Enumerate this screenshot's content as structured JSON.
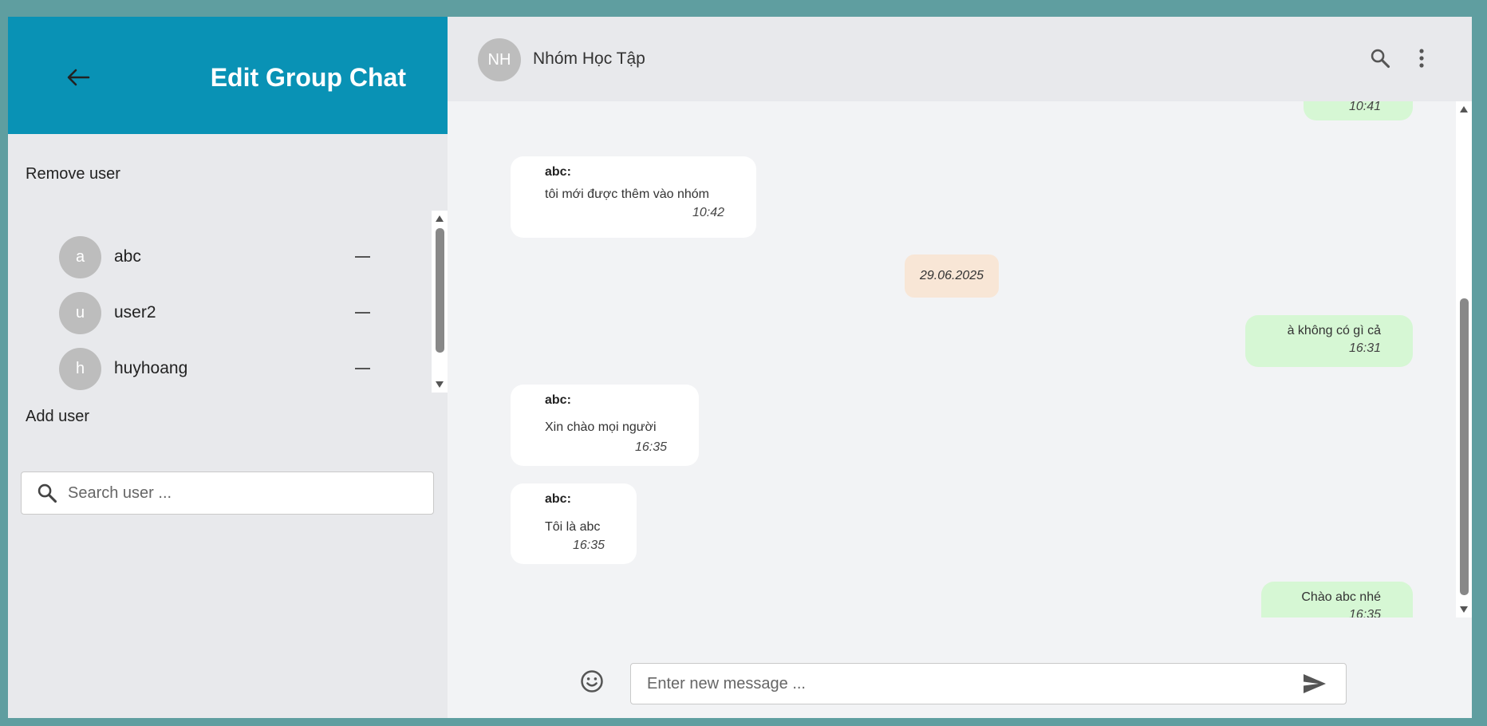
{
  "edit_panel": {
    "title": "Edit Group Chat",
    "remove_label": "Remove user",
    "add_label": "Add user",
    "search_placeholder": "Search user ...",
    "members": [
      {
        "initial": "a",
        "name": "abc"
      },
      {
        "initial": "u",
        "name": "user2"
      },
      {
        "initial": "h",
        "name": "huyhoang"
      }
    ]
  },
  "chat": {
    "avatar_initials": "NH",
    "name": "Nhóm Học Tập",
    "messages": [
      {
        "type": "out",
        "time": "10:41"
      },
      {
        "type": "in",
        "sender": "abc:",
        "text": "tôi mới được thêm vào nhóm",
        "time": "10:42"
      },
      {
        "type": "date",
        "text": "29.06.2025"
      },
      {
        "type": "out",
        "text": "à không có gì cả",
        "time": "16:31"
      },
      {
        "type": "in",
        "sender": "abc:",
        "text": "Xin chào mọi người",
        "time": "16:35"
      },
      {
        "type": "in",
        "sender": "abc:",
        "text": "Tôi là abc",
        "time": "16:35"
      },
      {
        "type": "out",
        "text": "Chào abc nhé",
        "time": "16:35"
      }
    ],
    "input_placeholder": "Enter new message ..."
  },
  "icons": {
    "back": "arrow-left-icon",
    "search": "search-icon",
    "more": "more-vert-icon",
    "emoji": "smiley-icon",
    "send": "send-icon",
    "remove": "minus-icon"
  },
  "colors": {
    "header_blue": "#0992b5",
    "outgoing_bubble": "#d6f7d4",
    "incoming_bubble": "#ffffff",
    "date_pill": "#f8e6d6",
    "frame": "#5f9ea0"
  }
}
